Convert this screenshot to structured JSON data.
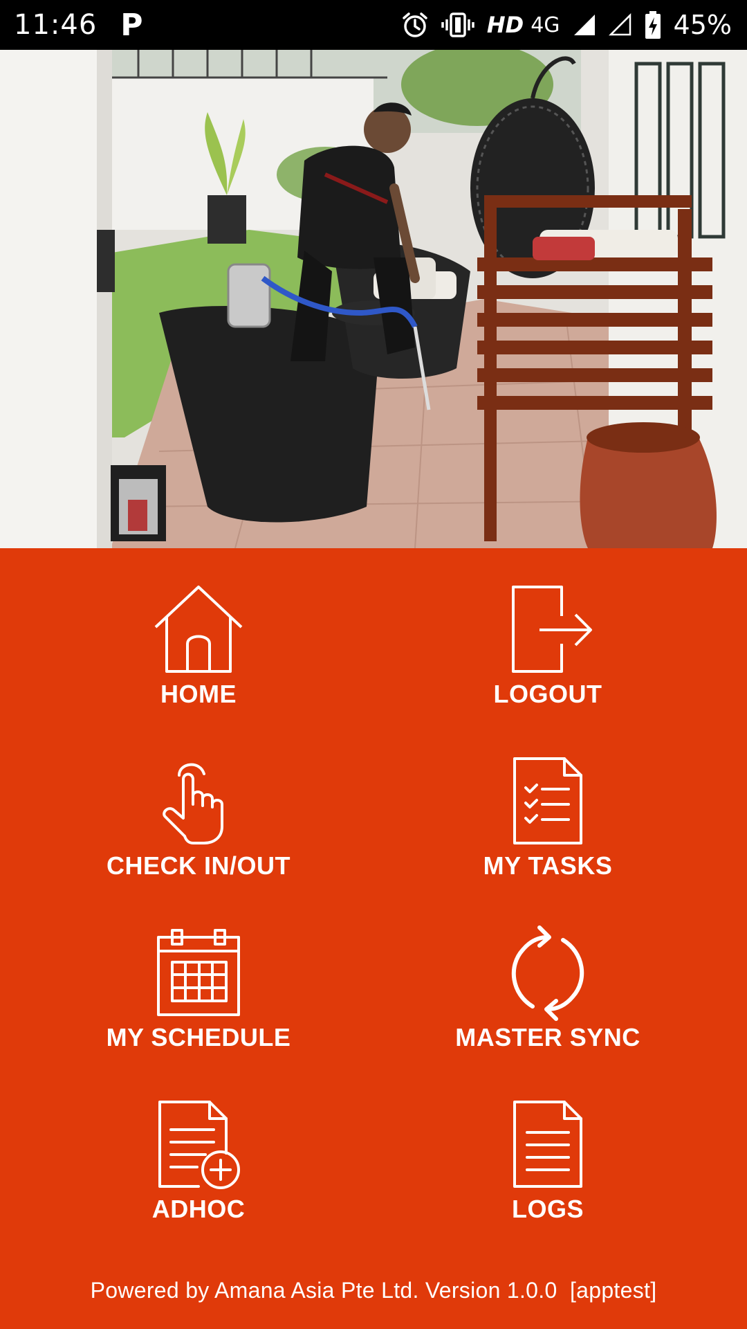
{
  "status_bar": {
    "time": "11:46",
    "notification_glyph": "P",
    "hd": "HD",
    "network": "4G",
    "battery": "45%",
    "icons": [
      "alarm-icon",
      "vibrate-icon",
      "signal-icon",
      "signal-empty-icon",
      "battery-charging-icon"
    ]
  },
  "hero": {
    "image": "photo of a pest-control technician spraying outdoor wicker furniture on a patio"
  },
  "menu": {
    "items": [
      {
        "label": "HOME",
        "icon": "home-icon"
      },
      {
        "label": "LOGOUT",
        "icon": "logout-icon"
      },
      {
        "label": "CHECK IN/OUT",
        "icon": "tap-hand-icon"
      },
      {
        "label": "MY TASKS",
        "icon": "task-list-icon"
      },
      {
        "label": "MY SCHEDULE",
        "icon": "calendar-icon"
      },
      {
        "label": "MASTER SYNC",
        "icon": "sync-icon"
      },
      {
        "label": "ADHOC",
        "icon": "document-add-icon"
      },
      {
        "label": "LOGS",
        "icon": "document-icon"
      }
    ]
  },
  "footer": {
    "text": "Powered by Amana Asia Pte Ltd. Version 1.0.0  [apptest]"
  },
  "colors": {
    "brand_orange": "#e03a0a",
    "status_bar": "#000000",
    "text": "#ffffff"
  }
}
